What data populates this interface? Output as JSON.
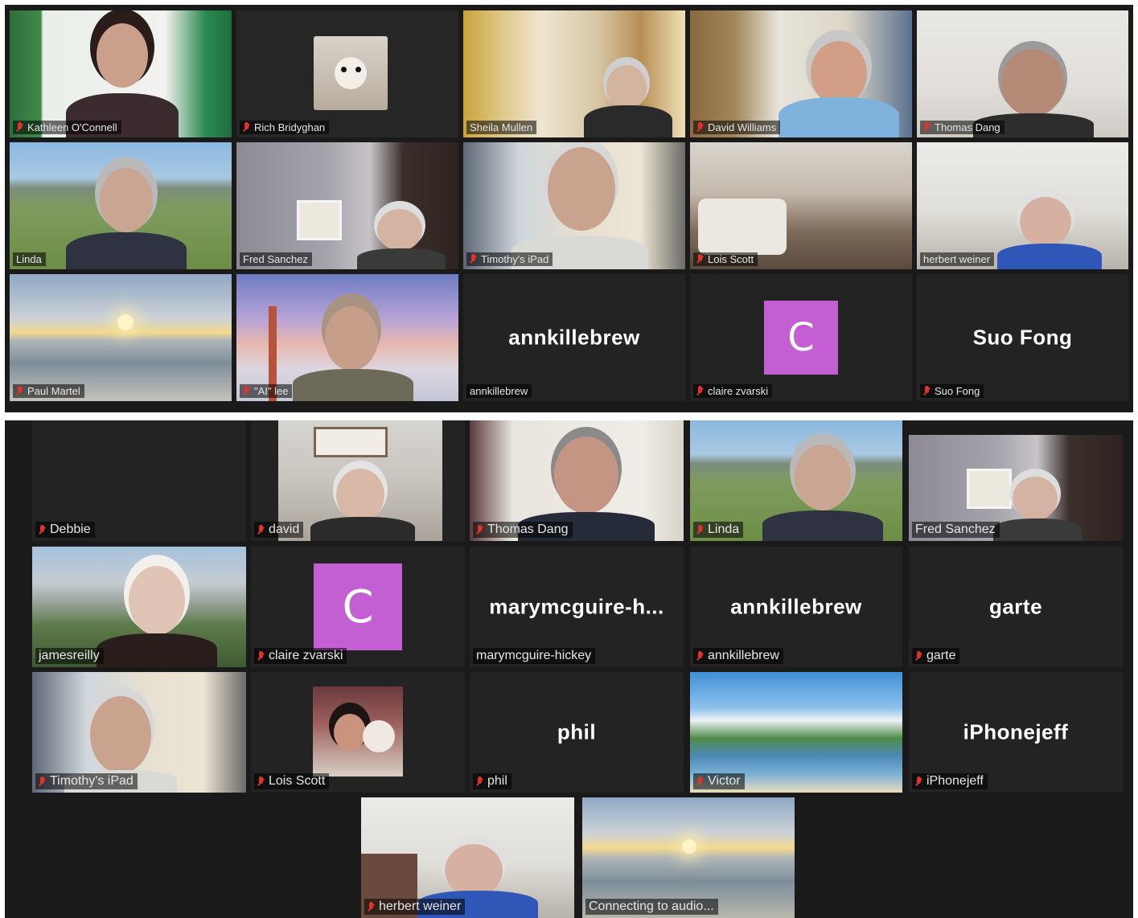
{
  "top_panel": {
    "tiles": [
      {
        "name": "Kathleen O'Connell",
        "muted": true,
        "type": "video"
      },
      {
        "name": "Rich Bridyghan",
        "muted": true,
        "type": "video"
      },
      {
        "name": "Sheila Mullen",
        "muted": false,
        "type": "video"
      },
      {
        "name": "David Williams",
        "muted": true,
        "type": "video"
      },
      {
        "name": "Thomas Dang",
        "muted": true,
        "type": "video"
      },
      {
        "name": "Linda",
        "muted": false,
        "type": "video"
      },
      {
        "name": "Fred Sanchez",
        "muted": false,
        "type": "video"
      },
      {
        "name": "Timothy's iPad",
        "muted": true,
        "type": "video"
      },
      {
        "name": "Lois Scott",
        "muted": true,
        "type": "video"
      },
      {
        "name": "herbert weiner",
        "muted": false,
        "type": "video"
      },
      {
        "name": "Paul Martel",
        "muted": true,
        "type": "video"
      },
      {
        "name": "\"AI\" lee",
        "muted": true,
        "type": "video"
      },
      {
        "name": "annkillebrew",
        "muted": false,
        "type": "name",
        "display": "annkillebrew",
        "active_speaker": true
      },
      {
        "name": "claire zvarski",
        "muted": true,
        "type": "avatar",
        "initial": "C"
      },
      {
        "name": "Suo Fong",
        "muted": true,
        "type": "name",
        "display": "Suo Fong"
      }
    ]
  },
  "bottom_panel": {
    "tiles": [
      {
        "name": "Debbie",
        "muted": true,
        "type": "blank"
      },
      {
        "name": "david",
        "muted": true,
        "type": "video"
      },
      {
        "name": "Thomas Dang",
        "muted": true,
        "type": "video"
      },
      {
        "name": "Linda",
        "muted": true,
        "type": "video"
      },
      {
        "name": "Fred Sanchez",
        "muted": false,
        "type": "video"
      },
      {
        "name": "jamesreilly",
        "muted": false,
        "type": "video"
      },
      {
        "name": "claire zvarski",
        "muted": true,
        "type": "avatar",
        "initial": "C"
      },
      {
        "name": "marymcguire-hickey",
        "muted": false,
        "type": "name",
        "display": "marymcguire-h..."
      },
      {
        "name": "annkillebrew",
        "muted": true,
        "type": "name",
        "display": "annkillebrew"
      },
      {
        "name": "garte",
        "muted": true,
        "type": "name",
        "display": "garte"
      },
      {
        "name": "Timothy's iPad",
        "muted": true,
        "type": "video"
      },
      {
        "name": "Lois Scott",
        "muted": true,
        "type": "video"
      },
      {
        "name": "phil",
        "muted": true,
        "type": "name",
        "display": "phil"
      },
      {
        "name": "Victor",
        "muted": true,
        "type": "video"
      },
      {
        "name": "iPhonejeff",
        "muted": true,
        "type": "name",
        "display": "iPhonejeff"
      },
      {
        "name": "herbert weiner",
        "muted": true,
        "type": "video"
      },
      {
        "name": "Connecting to audio...",
        "muted": false,
        "type": "video"
      }
    ]
  },
  "colors": {
    "panel_bg": "#1a1a1a",
    "tile_bg": "#232323",
    "active_speaker_border": "#cddc6c",
    "avatar_bg": "#c35fd3",
    "muted_icon": "#e0332b"
  }
}
